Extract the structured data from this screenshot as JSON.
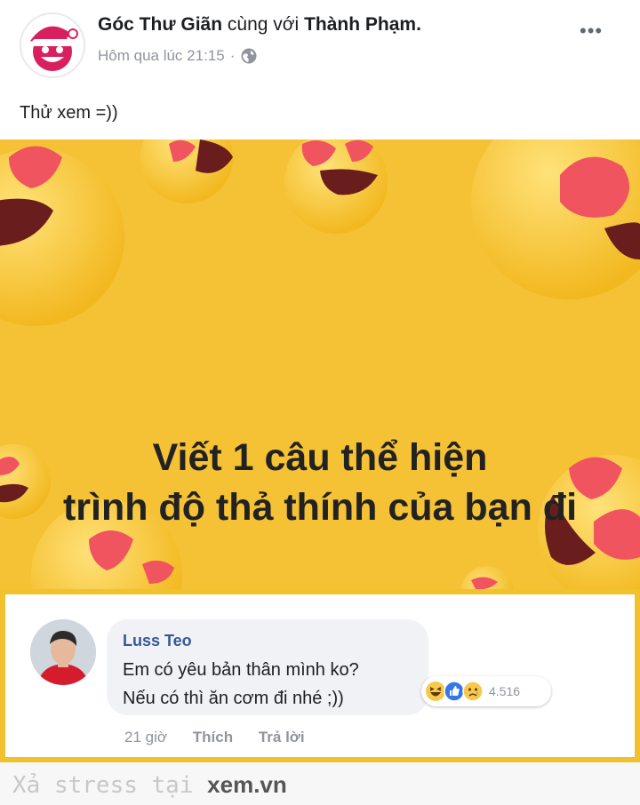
{
  "post": {
    "author": "Góc Thư Giãn",
    "with_text": "cùng với",
    "tagged": "Thành Phạm.",
    "time": "Hôm qua lúc 21:15",
    "separator": "·",
    "more": "•••",
    "icons": {
      "avatar": "santa-smiley-logo",
      "privacy": "globe-icon",
      "more": "more-options-icon"
    },
    "text": "Thử xem =))"
  },
  "banner": {
    "line1": "Viết 1 câu thể hiện",
    "line2": "trình độ thả thính của bạn đi",
    "background": "#f5c235"
  },
  "comment": {
    "author": "Luss Teo",
    "line1": "Em có yêu bản thân mình ko?",
    "line2": "Nếu có thì ăn cơm đi nhé ;))",
    "reactions": [
      "haha-icon",
      "like-icon",
      "sad-icon"
    ],
    "reaction_count": "4.516",
    "time": "21 giờ",
    "like_label": "Thích",
    "reply_label": "Trả lời",
    "border_color": "#f2c12e"
  },
  "watermark": {
    "prefix": "Xả stress tại",
    "site": "xem.vn"
  }
}
